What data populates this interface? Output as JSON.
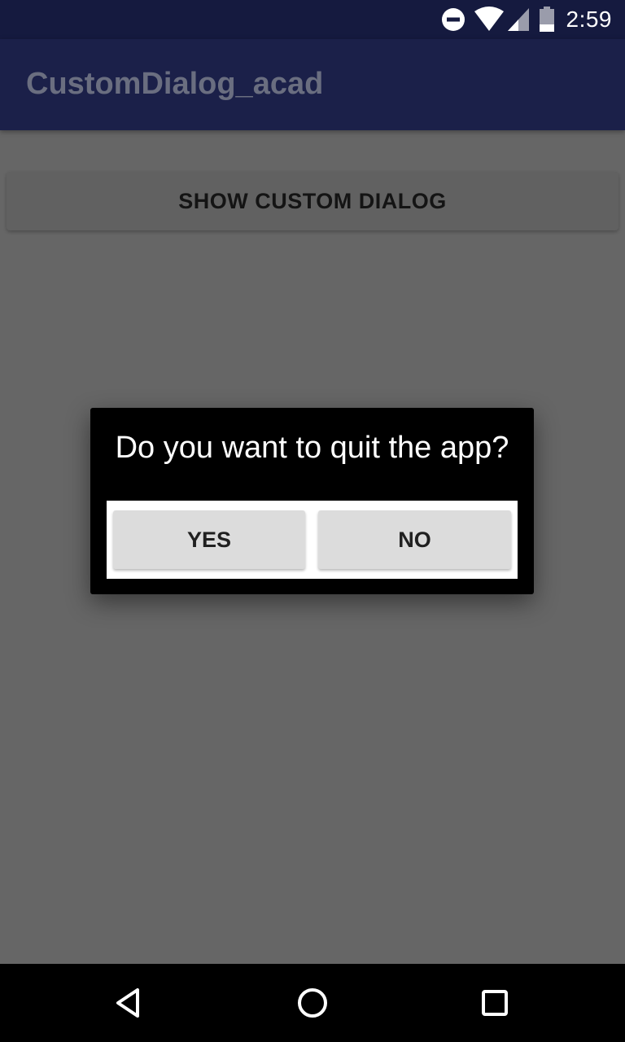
{
  "status_bar": {
    "time": "2:59",
    "icons": [
      "do-not-disturb-icon",
      "wifi-icon",
      "cell-signal-icon",
      "battery-icon"
    ]
  },
  "app_bar": {
    "title": "CustomDialog_acad"
  },
  "main": {
    "show_dialog_label": "SHOW CUSTOM DIALOG"
  },
  "dialog": {
    "message": "Do you want to quit the app?",
    "yes_label": "YES",
    "no_label": "NO"
  },
  "nav_bar": {
    "icons": [
      "back-icon",
      "home-icon",
      "recents-icon"
    ]
  },
  "colors": {
    "status_bar": "#151a3f",
    "app_bar": "#1b2049",
    "scrim_background": "#666666",
    "dialog_background": "#000000",
    "button_gray": "#dcdcdc"
  }
}
